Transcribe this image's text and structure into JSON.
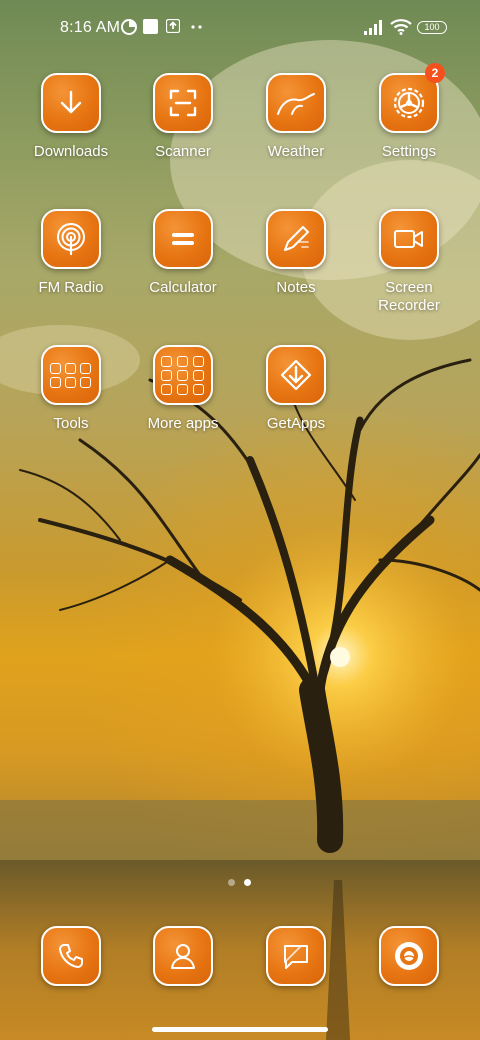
{
  "status_bar": {
    "time": "8:16 AM",
    "battery": "100",
    "icons": [
      "data-saver-icon",
      "square-notification-icon",
      "upload-notification-icon",
      "more-dots-icon",
      "signal-icon",
      "wifi-icon",
      "battery-icon"
    ]
  },
  "apps": [
    {
      "label": "Downloads",
      "icon": "download-icon"
    },
    {
      "label": "Scanner",
      "icon": "scanner-icon"
    },
    {
      "label": "Weather",
      "icon": "weather-icon"
    },
    {
      "label": "Settings",
      "icon": "gear-icon",
      "badge": "2"
    },
    {
      "label": "FM Radio",
      "icon": "radio-icon"
    },
    {
      "label": "Calculator",
      "icon": "calculator-icon"
    },
    {
      "label": "Notes",
      "icon": "pencil-icon"
    },
    {
      "label": "Screen\nRecorder",
      "icon": "video-camera-icon"
    },
    {
      "label": "Tools",
      "icon": "folder-icon"
    },
    {
      "label": "More apps",
      "icon": "folder-icon"
    },
    {
      "label": "GetApps",
      "icon": "getapps-icon"
    }
  ],
  "dock": [
    {
      "icon": "phone-icon"
    },
    {
      "icon": "contacts-icon"
    },
    {
      "icon": "message-icon"
    },
    {
      "icon": "camera-icon"
    }
  ],
  "page_indicator": {
    "pages": 2,
    "current": 2
  },
  "colors": {
    "accent": "#e77512",
    "badge": "#f4511e"
  }
}
